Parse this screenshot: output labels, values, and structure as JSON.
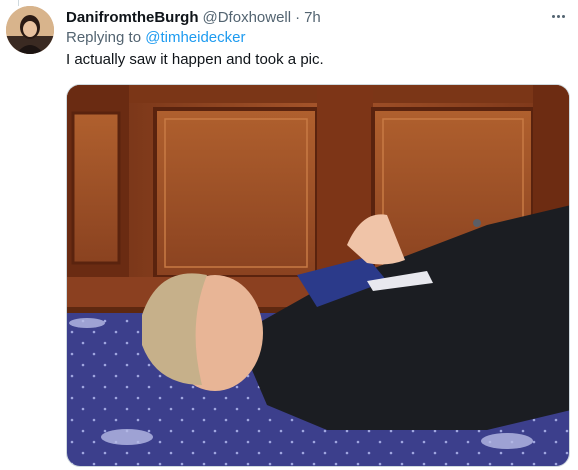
{
  "tweet": {
    "display_name": "DanifromtheBurgh",
    "handle": "@Dfoxhowell",
    "separator": "·",
    "time": "7h",
    "replying_prefix": "Replying to ",
    "replying_to": "@timheidecker",
    "text": "I actually saw it happen and took a pic."
  },
  "icons": {
    "more": "more-horizontal-icon"
  },
  "colors": {
    "link": "#1d9bf0",
    "secondary_text": "#536471",
    "primary_text": "#0f1419"
  }
}
